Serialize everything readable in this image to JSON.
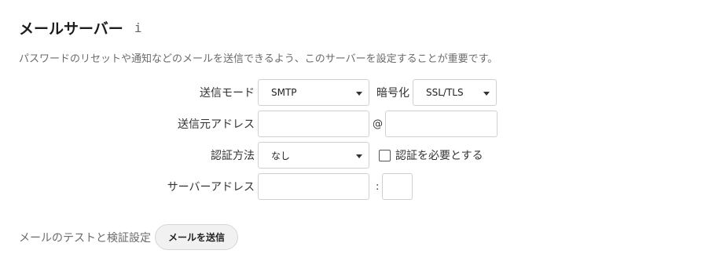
{
  "section": {
    "title": "メールサーバー",
    "info_icon": "i",
    "description": "パスワードのリセットや通知などのメールを送信できるよう、このサーバーを設定することが重要です。"
  },
  "form": {
    "send_mode": {
      "label": "送信モード",
      "value": "SMTP"
    },
    "encryption": {
      "label": "暗号化",
      "value": "SSL/TLS"
    },
    "from_address": {
      "label": "送信元アドレス",
      "local_value": "",
      "at": "@",
      "domain_value": ""
    },
    "auth_method": {
      "label": "認証方法",
      "value": "なし"
    },
    "auth_required": {
      "label": "認証を必要とする",
      "checked": false
    },
    "server_address": {
      "label": "サーバーアドレス",
      "host_value": "",
      "colon": ":",
      "port_value": ""
    }
  },
  "test": {
    "label": "メールのテストと検証設定",
    "button_label": "メールを送信"
  }
}
